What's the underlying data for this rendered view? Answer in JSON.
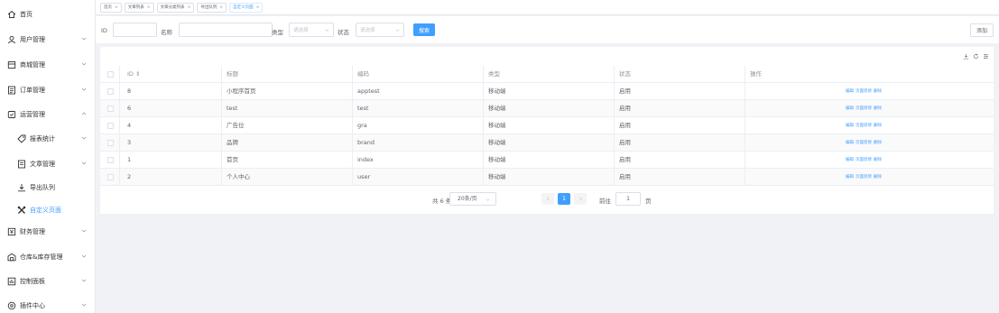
{
  "sidebar": {
    "items": [
      {
        "label": "首页",
        "icon": "home-icon",
        "level": 1,
        "expandable": false
      },
      {
        "label": "用户管理",
        "icon": "user-icon",
        "level": 1,
        "expandable": true
      },
      {
        "label": "商城管理",
        "icon": "store-icon",
        "level": 1,
        "expandable": true
      },
      {
        "label": "订单管理",
        "icon": "order-icon",
        "level": 1,
        "expandable": true
      },
      {
        "label": "运营管理",
        "icon": "operation-icon",
        "level": 1,
        "expandable": true,
        "expanded": true
      },
      {
        "label": "报表统计",
        "icon": "tag-icon",
        "level": 2,
        "expandable": true
      },
      {
        "label": "文章管理",
        "icon": "article-icon",
        "level": 2,
        "expandable": true
      },
      {
        "label": "导出队列",
        "icon": "export-icon",
        "level": 2,
        "expandable": false
      },
      {
        "label": "自定义页面",
        "icon": "custom-page-icon",
        "level": 2,
        "expandable": false,
        "active": true
      },
      {
        "label": "财务管理",
        "icon": "finance-icon",
        "level": 1,
        "expandable": true
      },
      {
        "label": "仓库&库存管理",
        "icon": "warehouse-icon",
        "level": 1,
        "expandable": true
      },
      {
        "label": "控制面板",
        "icon": "dashboard-icon",
        "level": 1,
        "expandable": true
      },
      {
        "label": "插件中心",
        "icon": "plugin-icon",
        "level": 1,
        "expandable": true
      }
    ]
  },
  "tabs": [
    {
      "label": "首页",
      "active": false
    },
    {
      "label": "文章列表",
      "active": false
    },
    {
      "label": "文章分类列表",
      "active": false
    },
    {
      "label": "导出队列",
      "active": false
    },
    {
      "label": "自定义页面",
      "active": true
    }
  ],
  "tab_close": "×",
  "search": {
    "id_label": "ID",
    "name_label": "名称",
    "type_label": "类型",
    "type_placeholder": "请选择",
    "status_label": "状态",
    "status_placeholder": "请选择",
    "search_button": "搜索",
    "add_button": "添加"
  },
  "table": {
    "columns": [
      "ID",
      "标题",
      "编码",
      "类型",
      "状态",
      "操作"
    ],
    "sort_indicator": "⇕",
    "rows": [
      {
        "id": "8",
        "title": "小程序首页",
        "code": "apptest",
        "type": "移动端",
        "status": "启用"
      },
      {
        "id": "6",
        "title": "test",
        "code": "test",
        "type": "移动端",
        "status": "启用"
      },
      {
        "id": "4",
        "title": "广告位",
        "code": "gra",
        "type": "移动端",
        "status": "启用"
      },
      {
        "id": "3",
        "title": "品牌",
        "code": "brand",
        "type": "移动端",
        "status": "启用"
      },
      {
        "id": "1",
        "title": "首页",
        "code": "index",
        "type": "移动端",
        "status": "启用"
      },
      {
        "id": "2",
        "title": "个人中心",
        "code": "user",
        "type": "移动端",
        "status": "启用"
      }
    ],
    "actions": [
      "编辑",
      "页面装修",
      "删除"
    ]
  },
  "pagination": {
    "total": "共 6 条",
    "page_size": "20条/页",
    "current_page": "1",
    "goto_label": "前往",
    "goto_value": "1",
    "goto_unit": "页"
  },
  "colors": {
    "accent": "#409eff",
    "text": "#606266"
  }
}
